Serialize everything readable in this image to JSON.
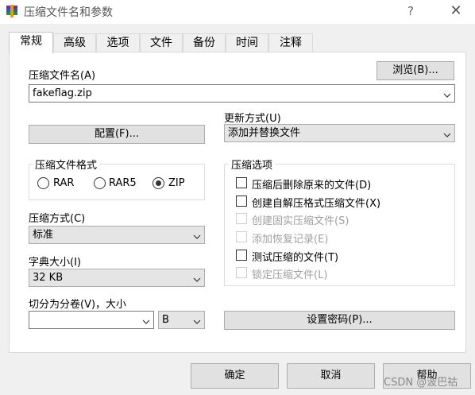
{
  "window": {
    "title": "压缩文件名和参数",
    "help_glyph": "?",
    "close_glyph": "✕"
  },
  "tabs": [
    {
      "label": "常规",
      "active": true
    },
    {
      "label": "高级"
    },
    {
      "label": "选项"
    },
    {
      "label": "文件"
    },
    {
      "label": "备份"
    },
    {
      "label": "时间"
    },
    {
      "label": "注释"
    }
  ],
  "archive_name": {
    "label": "压缩文件名(A)",
    "value": "fakeflag.zip",
    "browse_label": "浏览(B)..."
  },
  "profiles_button": "配置(F)...",
  "update_mode": {
    "label": "更新方式(U)",
    "value": "添加并替换文件"
  },
  "archive_format": {
    "title": "压缩文件格式",
    "options": [
      "RAR",
      "RAR5",
      "ZIP"
    ],
    "selected": "ZIP"
  },
  "compression_method": {
    "label": "压缩方式(C)",
    "value": "标准"
  },
  "dictionary_size": {
    "label": "字典大小(I)",
    "value": "32 KB"
  },
  "split_volumes": {
    "label": "切分为分卷(V)，大小",
    "value": "",
    "unit": "B"
  },
  "archive_options": {
    "title": "压缩选项",
    "items": [
      {
        "label": "压缩后删除原来的文件(D)",
        "checked": false,
        "enabled": true
      },
      {
        "label": "创建自解压格式压缩文件(X)",
        "checked": false,
        "enabled": true
      },
      {
        "label": "创建固实压缩文件(S)",
        "checked": false,
        "enabled": false
      },
      {
        "label": "添加恢复记录(E)",
        "checked": false,
        "enabled": false
      },
      {
        "label": "测试压缩的文件(T)",
        "checked": false,
        "enabled": true
      },
      {
        "label": "锁定压缩文件(L)",
        "checked": false,
        "enabled": false
      }
    ]
  },
  "set_password_button": "设置密码(P)...",
  "footer": {
    "ok": "确定",
    "cancel": "取消",
    "help": "帮助"
  },
  "watermark": "CSDN @波巴祜",
  "colors": {
    "window_bg": "#f0f0f0",
    "panel_bg": "#ffffff",
    "button_bg": "#e1e1e1",
    "combo_bg": "#e5e5e5",
    "disabled_text": "#a0a0a0"
  },
  "icons": {
    "app": "winrar-icon",
    "dropdown": "chevron-down-icon"
  }
}
